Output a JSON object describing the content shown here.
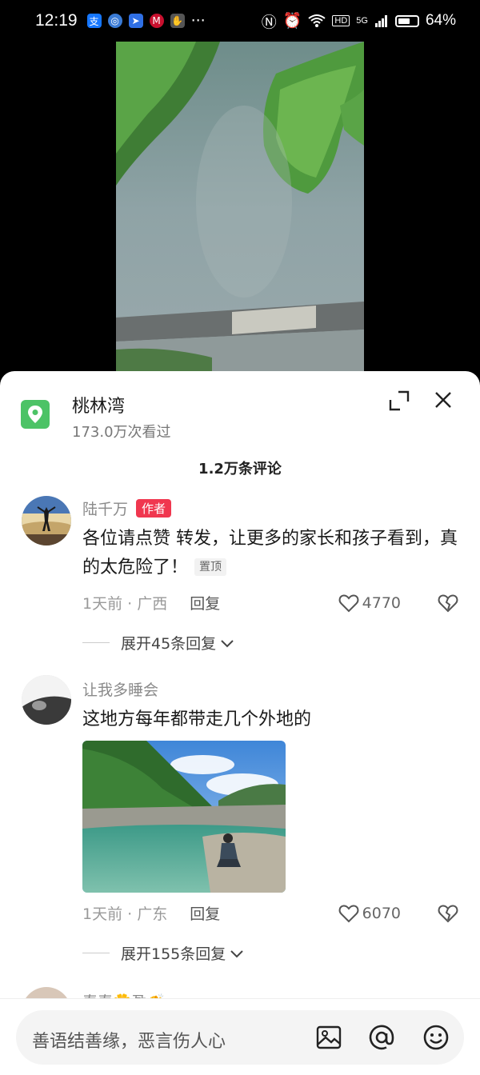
{
  "status_bar": {
    "time": "12:19",
    "dots": "···",
    "network": "5G",
    "battery_text": "64%",
    "battery_level": 0.64
  },
  "location": {
    "title": "桃林湾",
    "views": "173.0万次看过"
  },
  "comments_header": "1.2万条评论",
  "comments": [
    {
      "user": "陆千万",
      "badge": "作者",
      "text": "各位请点赞 转发，让更多的家长和孩子看到，真的太危险了！",
      "pinned": "置顶",
      "time_location": "1天前 · 广西",
      "reply_label": "回复",
      "likes": "4770",
      "expand": "展开45条回复"
    },
    {
      "user": "让我多睡会",
      "text": "这地方每年都带走几个外地的",
      "time_location": "1天前 · 广东",
      "reply_label": "回复",
      "likes": "6070",
      "expand": "展开155条回复"
    },
    {
      "user": "春春🌼盈👏"
    }
  ],
  "input": {
    "placeholder": "善语结善缘，恶言伤人心"
  },
  "icons": [
    "location-pin-icon",
    "expand-icon",
    "close-icon",
    "heart-icon",
    "heart-broken-icon",
    "chevron-down-icon",
    "image-icon",
    "at-icon",
    "emoji-icon"
  ],
  "colors": {
    "author_badge": "#f0374f",
    "location_icon": "#4cc366"
  }
}
